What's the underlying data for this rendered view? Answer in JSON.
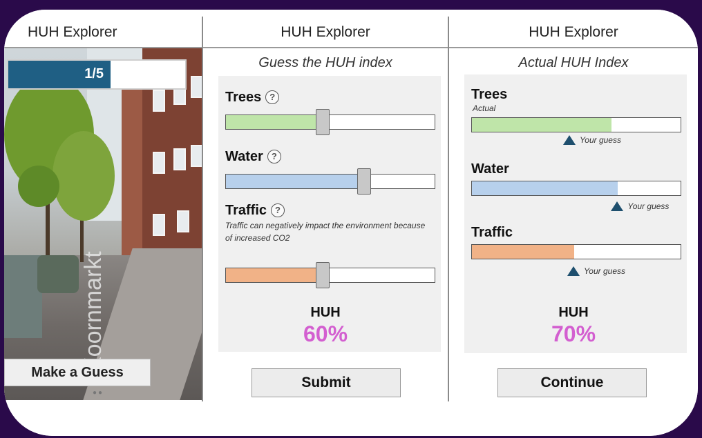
{
  "app_title": "HUH Explorer",
  "panel1": {
    "progress_text": "1/5",
    "progress_fraction": 0.2,
    "street_label": "Koornmarkt",
    "guess_button": "Make a Guess"
  },
  "panel2": {
    "subtitle": "Guess the HUH index",
    "help_glyph": "?",
    "sliders": [
      {
        "label": "Trees",
        "value": 0.46,
        "color": "#bfe5a9"
      },
      {
        "label": "Water",
        "value": 0.66,
        "color": "#b7d0ec"
      },
      {
        "label": "Traffic",
        "value": 0.46,
        "color": "#f1b287"
      }
    ],
    "traffic_note": "Traffic can negatively impact the environment because of increased CO2",
    "huh_label": "HUH",
    "huh_value": "60%",
    "submit_button": "Submit"
  },
  "panel3": {
    "subtitle": "Actual HUH Index",
    "actual_label": "Actual",
    "guess_marker": "Your guess",
    "bars": [
      {
        "label": "Trees",
        "value": 0.67,
        "guess": 0.47,
        "color": "#bfe5a9"
      },
      {
        "label": "Water",
        "value": 0.7,
        "guess": 0.7,
        "color": "#b7d0ec"
      },
      {
        "label": "Traffic",
        "value": 0.49,
        "guess": 0.49,
        "color": "#f1b287"
      }
    ],
    "huh_label": "HUH",
    "huh_value": "70%",
    "continue_button": "Continue"
  },
  "colors": {
    "accent": "#1f5f84",
    "huh": "#d35fd0",
    "marker": "#1e4f6e"
  }
}
